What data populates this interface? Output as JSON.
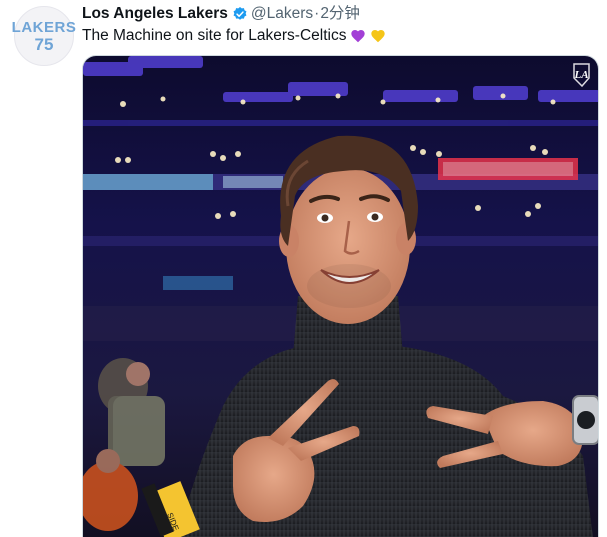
{
  "avatar": {
    "line1": "LAKERS",
    "line2": "75"
  },
  "author": {
    "name": "Los Angeles Lakers",
    "handle": "@Lakers",
    "time": "2分钟"
  },
  "tweet": {
    "text": "The Machine on site for Lakers-Celtics"
  },
  "media": {
    "watermark": "LA",
    "wristband": "SIDE"
  },
  "colors": {
    "verified": "#1d9bf0",
    "purple_heart": "#a23fd6",
    "yellow_heart": "#f5c518",
    "lakers_gold": "#f4c430"
  }
}
